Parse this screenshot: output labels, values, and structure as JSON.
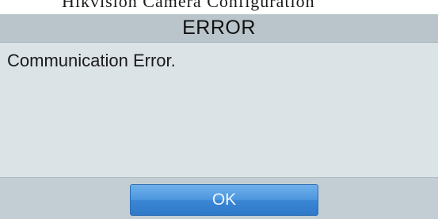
{
  "background_text": "Hikvision Camera Configuration",
  "dialog": {
    "title": "ERROR",
    "message": "Communication Error.",
    "ok_label": "OK"
  },
  "colors": {
    "title_bar": "#b9c5cb",
    "message_area": "#dbe3e7",
    "footer": "#c3ced4",
    "button_blue": "#4d97df"
  }
}
